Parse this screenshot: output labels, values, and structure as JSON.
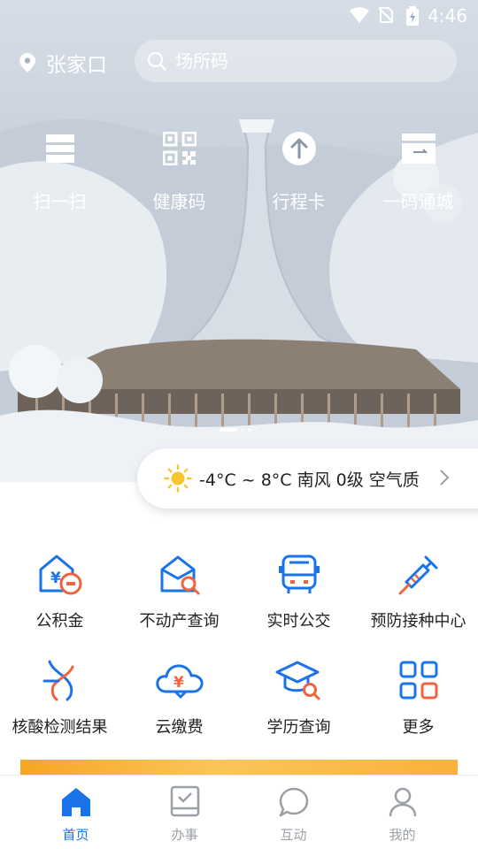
{
  "status_bar": {
    "time": "4:46"
  },
  "header": {
    "city": "张家口",
    "search_placeholder": "场所码"
  },
  "quick_actions": [
    {
      "label": "扫一扫",
      "icon": "scan-icon"
    },
    {
      "label": "健康码",
      "icon": "qr-code-icon"
    },
    {
      "label": "行程卡",
      "icon": "upload-arrow-icon"
    },
    {
      "label": "一码通城",
      "icon": "card-icon"
    }
  ],
  "carousel": {
    "count": 3,
    "active": 0
  },
  "weather": {
    "text": "-4°C ~ 8°C 南风 0级 空气质量"
  },
  "services": [
    {
      "label": "公积金",
      "icon": "housing-fund-icon"
    },
    {
      "label": "不动产查询",
      "icon": "real-estate-search-icon"
    },
    {
      "label": "实时公交",
      "icon": "bus-icon"
    },
    {
      "label": "预防接种中心",
      "icon": "syringe-icon"
    },
    {
      "label": "核酸检测结果",
      "icon": "dna-icon"
    },
    {
      "label": "云缴费",
      "icon": "cloud-payment-icon"
    },
    {
      "label": "学历查询",
      "icon": "education-search-icon"
    },
    {
      "label": "更多",
      "icon": "more-grid-icon"
    }
  ],
  "tabbar": [
    {
      "label": "首页",
      "icon": "home-icon",
      "active": true
    },
    {
      "label": "办事",
      "icon": "tasks-icon",
      "active": false
    },
    {
      "label": "互动",
      "icon": "chat-icon",
      "active": false
    },
    {
      "label": "我的",
      "icon": "profile-icon",
      "active": false
    }
  ],
  "colors": {
    "primary": "#1a73e8",
    "accent": "#f0633f",
    "inactive": "#9aa0a6"
  }
}
